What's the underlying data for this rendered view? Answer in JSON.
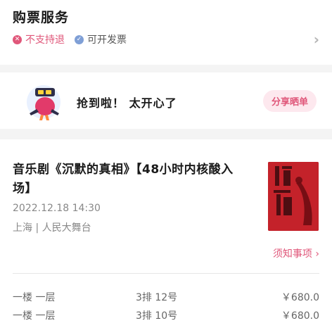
{
  "service": {
    "title": "购票服务",
    "no_refund_label": "不支持退",
    "invoice_label": "可开发票",
    "chevron": "›"
  },
  "share": {
    "message": "抢到啦！ 太开心了",
    "button_label": "分享晒单"
  },
  "order": {
    "show_title": "音乐剧《沉默的真相》【48小时内核酸入场】",
    "time": "2022.12.18 14:30",
    "venue": "上海 | 人民大舞台",
    "notice_label": "须知事项 ›",
    "tickets": [
      {
        "area": "一楼 一层",
        "seat": "3排 12号",
        "price": "￥680.0"
      },
      {
        "area": "一楼 一层",
        "seat": "3排 10号",
        "price": "￥680.0"
      }
    ]
  },
  "colors": {
    "accent": "#e0577a",
    "accent_bg": "#fde8ee",
    "invoice_icon": "#7f9fd6",
    "poster_red": "#c4222a"
  },
  "icons": {
    "no_refund": "close-circle-icon",
    "invoice": "check-circle-icon",
    "chevron": "chevron-right-icon",
    "avatar": "mascot-avatar-icon"
  }
}
